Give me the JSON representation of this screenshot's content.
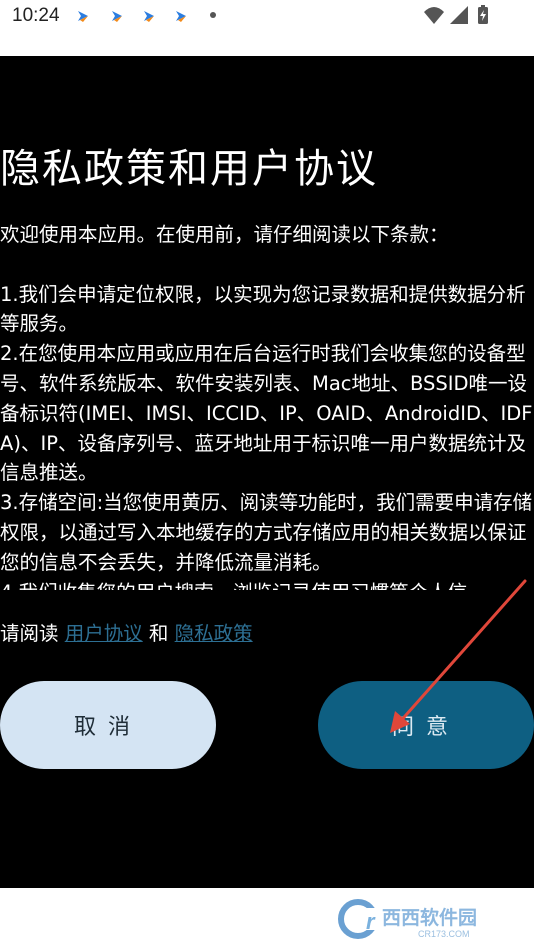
{
  "status_bar": {
    "time": "10:24",
    "notification_icons": [
      "app-notification-icon",
      "app-notification-icon",
      "app-notification-icon",
      "app-notification-icon"
    ],
    "indicators": [
      "wifi-icon",
      "signal-icon",
      "battery-charging-icon"
    ]
  },
  "dialog": {
    "title": "隐私政策和用户协议",
    "paragraphs": [
      "欢迎使用本应用。在使用前，请仔细阅读以下条款：",
      "",
      "1.我们会申请定位权限，以实现为您记录数据和提供数据分析等服务。",
      "2.在您使用本应用或应用在后台运行时我们会收集您的设备型号、软件系统版本、软件安装列表、Mac地址、BSSID唯一设备标识符(IMEI、IMSI、ICCID、IP、OAID、AndroidID、IDFA)、IP、设备序列号、蓝牙地址用于标识唯一用户数据统计及信息推送。",
      "3.存储空间:当您使用黄历、阅读等功能时，我们需要申请存储权限，以通过写入本地缓存的方式存储应用的相关数据以保证您的信息不会丢失，并降低流量消耗。",
      "4.我们收集您的用户搜索、浏览记录使用习惯等个人信"
    ],
    "links_prefix": "请阅读 ",
    "user_agreement_link": "用户协议",
    "links_and": " 和 ",
    "privacy_policy_link": "隐私政策",
    "cancel_label": "取消",
    "agree_label": "同意"
  },
  "colors": {
    "dialog_bg": "#000000",
    "link": "#2d6f93",
    "cancel_bg": "#d4e4f3",
    "agree_bg": "#0e5f82",
    "annotation_arrow": "#e0473a"
  },
  "watermark": {
    "logo_icon": "cr173-logo-icon",
    "text": "西西软件园",
    "url_text": "CR173.COM"
  }
}
